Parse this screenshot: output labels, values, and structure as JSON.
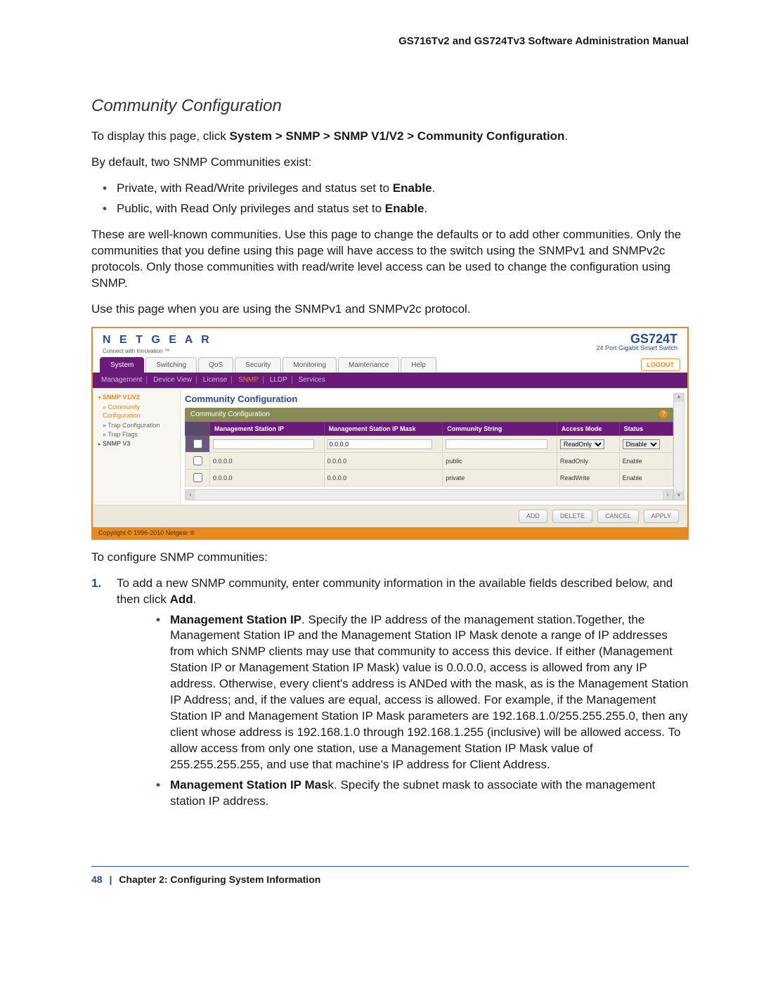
{
  "doc": {
    "manual_title": "GS716Tv2 and GS724Tv3 Software Administration Manual",
    "heading": "Community Configuration",
    "p1_a": "To display this page, click ",
    "p1_b": "System > SNMP > SNMP V1/V2 > Community Configuration",
    "p1_c": ".",
    "p2": "By default, two SNMP Communities exist:",
    "li1_a": "Private, with Read/Write privileges and status set to ",
    "li1_b": "Enable",
    "li1_c": ".",
    "li2_a": "Public, with Read Only privileges and status set to ",
    "li2_b": "Enable",
    "li2_c": ".",
    "p3": "These are well-known communities. Use this page to change the defaults or to add other communities. Only the communities that you define using this page will have access to the switch using the SNMPv1 and SNMPv2c protocols. Only those communities with read/write level access can be used to change the configuration using SNMP.",
    "p4": "Use this page when you are using the SNMPv1 and SNMPv2c protocol.",
    "p5": "To configure SNMP communities:",
    "ol1_num": "1.",
    "ol1_a": "To add a new SNMP community, enter community information in the available fields described below, and then click ",
    "ol1_b": "Add",
    "ol1_c": ".",
    "sub1_b": "Management Station IP",
    "sub1_t": ". Specify the IP address of the management station.Together, the Management Station IP and the Management Station IP Mask denote a range of IP addresses from which SNMP clients may use that community to access this device. If either (Management Station IP or Management Station IP Mask) value is 0.0.0.0, access is allowed from any IP address. Otherwise, every client's address is ANDed with the mask, as is the Management Station IP Address; and, if the values are equal, access is allowed. For example, if the Management Station IP and Management Station IP Mask parameters are 192.168.1.0/255.255.255.0, then any client whose address is 192.168.1.0 through 192.168.1.255 (inclusive) will be allowed access. To allow access from only one station, use a Management Station IP Mask value of 255.255.255.255, and use that machine's IP address for Client Address.",
    "sub2_b": "Management Station IP Mas",
    "sub2_t": "k. Specify the subnet mask to associate with the management station IP address.",
    "footer_page": "48",
    "footer_sep": "|",
    "footer_chap": "Chapter 2:  Configuring System Information"
  },
  "ui": {
    "brand": "N E T G E A R",
    "brand_tag": "Connect with Innovation ™",
    "model": "GS724T",
    "model_sub": "24 Port Gigabit Smart Switch",
    "logout": "LOGOUT",
    "tabs": [
      "System",
      "Switching",
      "QoS",
      "Security",
      "Monitoring",
      "Maintenance",
      "Help"
    ],
    "subtabs": [
      "Management",
      "Device View",
      "License",
      "SNMP",
      "LLDP",
      "Services"
    ],
    "side_hd1": "SNMP V1/V2",
    "side_itm1": "Community Configuration",
    "side_itm2": "Trap Configuration",
    "side_itm3": "Trap Flags",
    "side_hd2": "SNMP V3",
    "sec_title": "Community Configuration",
    "subbar": "Community Configuration",
    "help": "?",
    "th": [
      "",
      "Management Station IP",
      "Management Station IP Mask",
      "Community String",
      "Access Mode",
      "Status"
    ],
    "row_new_mask": "0.0.0.0",
    "sel_access": "ReadOnly",
    "sel_status": "Disable",
    "rows": [
      {
        "ip": "0.0.0.0",
        "mask": "0.0.0.0",
        "cs": "public",
        "am": "ReadOnly",
        "st": "Enable"
      },
      {
        "ip": "0.0.0.0",
        "mask": "0.0.0.0",
        "cs": "private",
        "am": "ReadWrite",
        "st": "Enable"
      }
    ],
    "btns": [
      "ADD",
      "DELETE",
      "CANCEL",
      "APPLY"
    ],
    "copyright": "Copyright © 1996-2010 Netgear ®"
  }
}
